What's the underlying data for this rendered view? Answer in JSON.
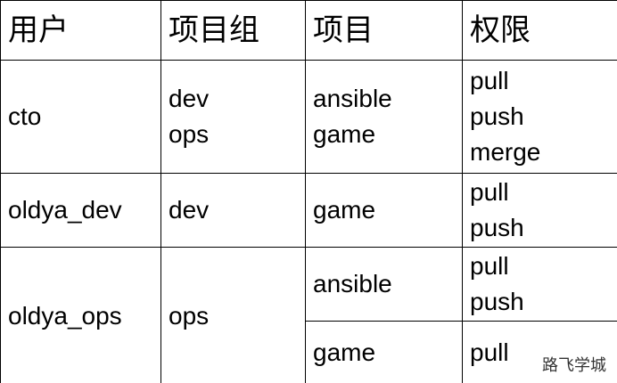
{
  "table": {
    "headers": [
      "用户",
      "项目组",
      "项目",
      "权限"
    ],
    "rows": [
      {
        "user": "cto",
        "groups": [
          "dev",
          "ops"
        ],
        "projects": [
          "ansible",
          "game"
        ],
        "permissions": [
          "pull",
          "push",
          "merge"
        ]
      },
      {
        "user": "oldya_dev",
        "groups": [
          "dev"
        ],
        "projects": [
          "game"
        ],
        "permissions": [
          "pull",
          "push"
        ]
      },
      {
        "user": "oldya_ops",
        "groups": [
          "ops"
        ],
        "project_entries": [
          {
            "project": "ansible",
            "permissions": [
              "pull",
              "push"
            ]
          },
          {
            "project": "game",
            "permissions": [
              "pull"
            ]
          }
        ]
      }
    ]
  },
  "watermark": "路飞学城"
}
